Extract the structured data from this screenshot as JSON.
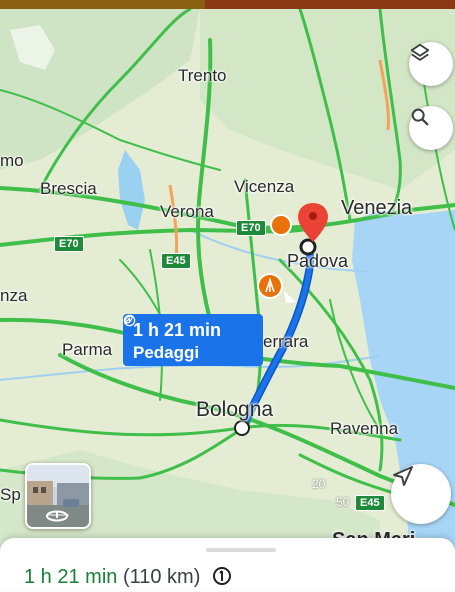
{
  "map": {
    "cities": {
      "trento": "Trento",
      "mo": "mo",
      "brescia": "Brescia",
      "vicenza": "Vicenza",
      "verona": "Verona",
      "venezia": "Venezia",
      "padova": "Padova",
      "nza": "nza",
      "ferrara": "errara",
      "parma": "Parma",
      "bologna": "Bologna",
      "ravenna": "Ravenna",
      "sp": "Sp",
      "sanmarino": "San Mari"
    },
    "road_badges": {
      "e70_left": "E70",
      "e70_mid": "E70",
      "e45_mid": "E45",
      "e45_right": "E45"
    },
    "scale": {
      "major": "20",
      "minor": "50"
    },
    "route_bubble": {
      "duration": "1 h 21 min",
      "toll_label": "Pedaggi"
    }
  },
  "controls": {
    "layers_icon": "layers-icon",
    "search_icon": "search-icon",
    "navigate_icon": "navigation-arrow-icon",
    "streetview_icon": "street-view-icon"
  },
  "sheet": {
    "duration": "1 h 21 min",
    "distance": "(110 km)"
  },
  "colors": {
    "route": "#1a73e8",
    "roads": "#3fbf4a",
    "duration_green": "#188038",
    "pin_red": "#ea4335",
    "poi_orange": "#e8710a"
  }
}
